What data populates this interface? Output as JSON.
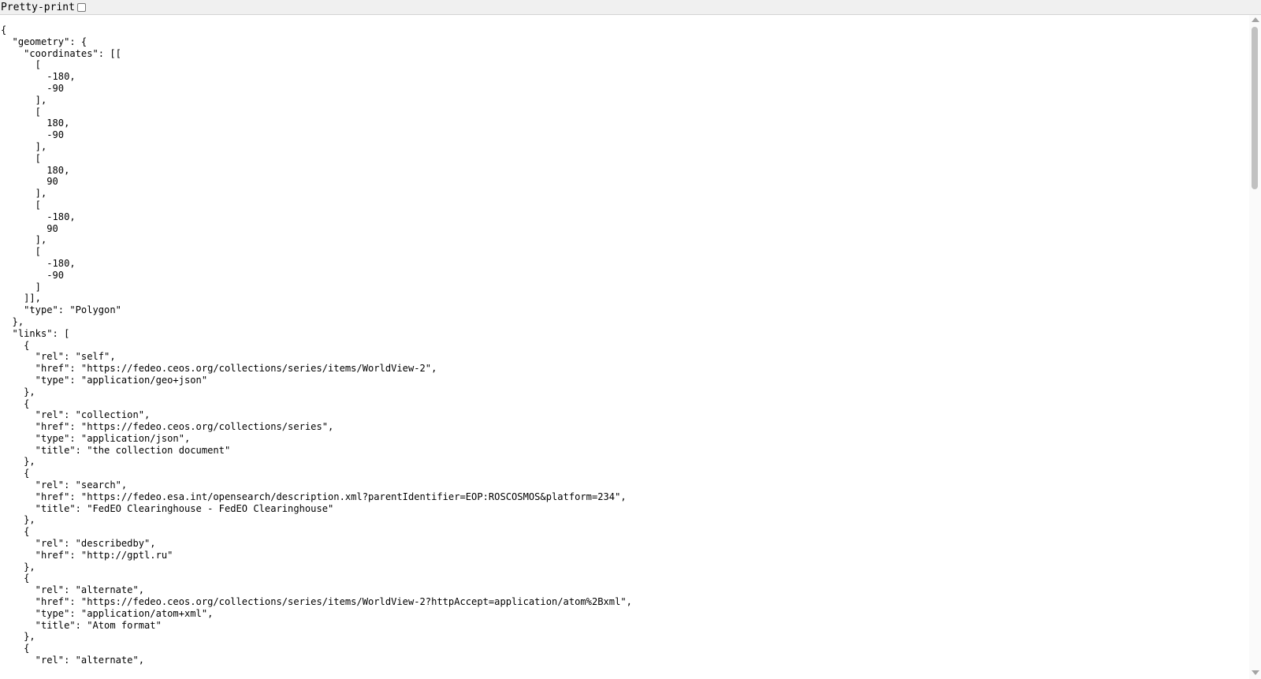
{
  "toolbar": {
    "pretty_print_label": "Pretty-print",
    "pretty_print_checked": false
  },
  "json_view": {
    "text": "{\n  \"geometry\": {\n    \"coordinates\": [[\n      [\n        -180,\n        -90\n      ],\n      [\n        180,\n        -90\n      ],\n      [\n        180,\n        90\n      ],\n      [\n        -180,\n        90\n      ],\n      [\n        -180,\n        -90\n      ]\n    ]],\n    \"type\": \"Polygon\"\n  },\n  \"links\": [\n    {\n      \"rel\": \"self\",\n      \"href\": \"https://fedeo.ceos.org/collections/series/items/WorldView-2\",\n      \"type\": \"application/geo+json\"\n    },\n    {\n      \"rel\": \"collection\",\n      \"href\": \"https://fedeo.ceos.org/collections/series\",\n      \"type\": \"application/json\",\n      \"title\": \"the collection document\"\n    },\n    {\n      \"rel\": \"search\",\n      \"href\": \"https://fedeo.esa.int/opensearch/description.xml?parentIdentifier=EOP:ROSCOSMOS&platform=234\",\n      \"title\": \"FedEO Clearinghouse - FedEO Clearinghouse\"\n    },\n    {\n      \"rel\": \"describedby\",\n      \"href\": \"http://gptl.ru\"\n    },\n    {\n      \"rel\": \"alternate\",\n      \"href\": \"https://fedeo.ceos.org/collections/series/items/WorldView-2?httpAccept=application/atom%2Bxml\",\n      \"type\": \"application/atom+xml\",\n      \"title\": \"Atom format\"\n    },\n    {\n      \"rel\": \"alternate\","
  }
}
